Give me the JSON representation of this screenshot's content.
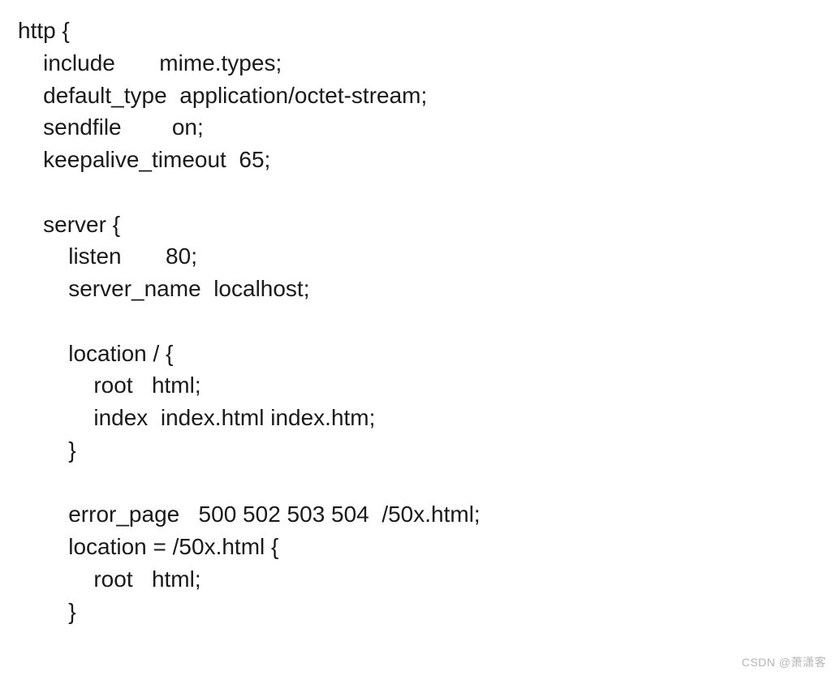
{
  "code": {
    "lines": [
      "http {",
      "    include       mime.types;",
      "    default_type  application/octet-stream;",
      "    sendfile        on;",
      "    keepalive_timeout  65;",
      "",
      "    server {",
      "        listen       80;",
      "        server_name  localhost;",
      "",
      "        location / {",
      "            root   html;",
      "            index  index.html index.htm;",
      "        }",
      "",
      "        error_page   500 502 503 504  /50x.html;",
      "        location = /50x.html {",
      "            root   html;",
      "        }"
    ]
  },
  "watermark": "CSDN @萧潇客"
}
